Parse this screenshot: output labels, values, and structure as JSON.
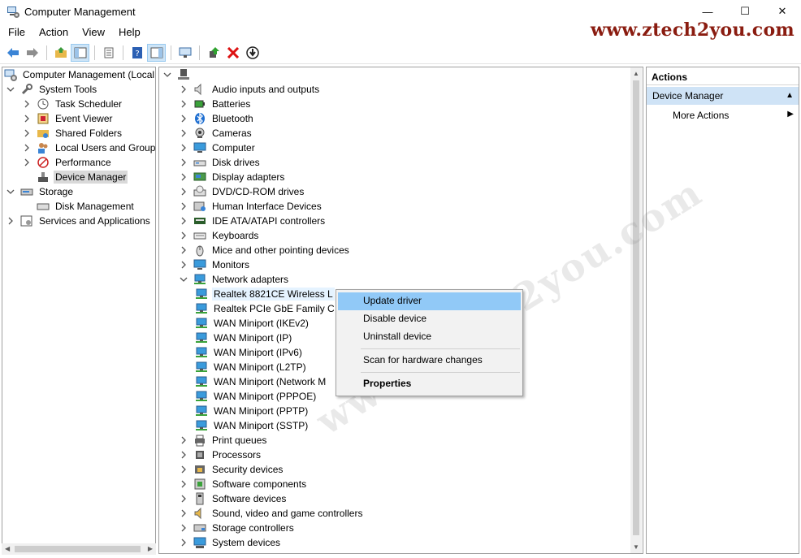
{
  "window": {
    "title": "Computer Management",
    "buttons": {
      "minimize": "—",
      "maximize": "☐",
      "close": "✕"
    }
  },
  "menu": [
    "File",
    "Action",
    "View",
    "Help"
  ],
  "watermark": "www.ztech2you.com",
  "left_tree": [
    {
      "label": "Computer Management (Local",
      "icon": "computer-management-icon",
      "indent": 0,
      "expander": ""
    },
    {
      "label": "System Tools",
      "icon": "system-tools-icon",
      "indent": 1,
      "expander": "v"
    },
    {
      "label": "Task Scheduler",
      "icon": "task-scheduler-icon",
      "indent": 2,
      "expander": ">"
    },
    {
      "label": "Event Viewer",
      "icon": "event-viewer-icon",
      "indent": 2,
      "expander": ">"
    },
    {
      "label": "Shared Folders",
      "icon": "shared-folders-icon",
      "indent": 2,
      "expander": ">"
    },
    {
      "label": "Local Users and Groups",
      "icon": "local-users-icon",
      "indent": 2,
      "expander": ">"
    },
    {
      "label": "Performance",
      "icon": "performance-icon",
      "indent": 2,
      "expander": ">"
    },
    {
      "label": "Device Manager",
      "icon": "device-manager-icon",
      "indent": 2,
      "expander": "",
      "selected": true
    },
    {
      "label": "Storage",
      "icon": "storage-icon",
      "indent": 1,
      "expander": "v"
    },
    {
      "label": "Disk Management",
      "icon": "disk-management-icon",
      "indent": 2,
      "expander": ""
    },
    {
      "label": "Services and Applications",
      "icon": "services-icon",
      "indent": 1,
      "expander": ">"
    }
  ],
  "device_tree": {
    "root_label": "",
    "categories_before": [
      {
        "label": "Audio inputs and outputs",
        "icon": "speaker-icon"
      },
      {
        "label": "Batteries",
        "icon": "battery-icon"
      },
      {
        "label": "Bluetooth",
        "icon": "bluetooth-icon"
      },
      {
        "label": "Cameras",
        "icon": "camera-icon"
      },
      {
        "label": "Computer",
        "icon": "computer-icon"
      },
      {
        "label": "Disk drives",
        "icon": "disk-drive-icon"
      },
      {
        "label": "Display adapters",
        "icon": "display-adapter-icon"
      },
      {
        "label": "DVD/CD-ROM drives",
        "icon": "dvd-icon"
      },
      {
        "label": "Human Interface Devices",
        "icon": "hid-icon"
      },
      {
        "label": "IDE ATA/ATAPI controllers",
        "icon": "ide-icon"
      },
      {
        "label": "Keyboards",
        "icon": "keyboard-icon"
      },
      {
        "label": "Mice and other pointing devices",
        "icon": "mouse-icon"
      },
      {
        "label": "Monitors",
        "icon": "monitor-icon"
      }
    ],
    "network_adapters": {
      "label": "Network adapters",
      "children": [
        "Realtek 8821CE Wireless L",
        "Realtek PCIe GbE Family C",
        "WAN Miniport (IKEv2)",
        "WAN Miniport (IP)",
        "WAN Miniport (IPv6)",
        "WAN Miniport (L2TP)",
        "WAN Miniport (Network M",
        "WAN Miniport (PPPOE)",
        "WAN Miniport (PPTP)",
        "WAN Miniport (SSTP)"
      ]
    },
    "categories_after": [
      {
        "label": "Print queues",
        "icon": "printer-icon"
      },
      {
        "label": "Processors",
        "icon": "processor-icon"
      },
      {
        "label": "Security devices",
        "icon": "security-device-icon"
      },
      {
        "label": "Software components",
        "icon": "software-component-icon"
      },
      {
        "label": "Software devices",
        "icon": "software-device-icon"
      },
      {
        "label": "Sound, video and game controllers",
        "icon": "sound-icon"
      },
      {
        "label": "Storage controllers",
        "icon": "storage-controller-icon"
      },
      {
        "label": "System devices",
        "icon": "system-devices-icon"
      }
    ]
  },
  "context_menu": {
    "update": "Update driver",
    "disable": "Disable device",
    "uninstall": "Uninstall device",
    "scan": "Scan for hardware changes",
    "properties": "Properties"
  },
  "actions": {
    "header": "Actions",
    "section": "Device Manager",
    "more": "More Actions"
  },
  "colors": {
    "accent": "#cfe3f6",
    "highlight": "#91c9f7",
    "watermark": "#8a1c10"
  }
}
